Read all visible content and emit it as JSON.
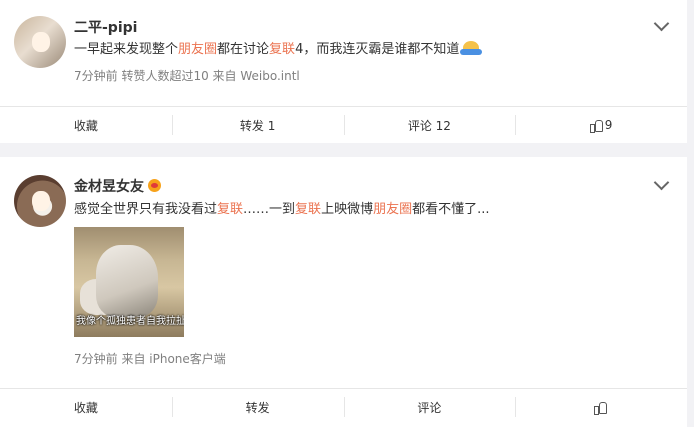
{
  "posts": [
    {
      "username": "二平-pipi",
      "text_parts": [
        "一早起来发现整个",
        "朋友圈",
        "都在讨论",
        "复联",
        "4，而我连灭霸是谁都不知道"
      ],
      "meta": "7分钟前 转赞人数超过10 来自 Weibo.intl",
      "actions": {
        "favorite": "收藏",
        "repost": "转发 1",
        "comment": "评论 12",
        "like": "9"
      }
    },
    {
      "username": "金材昱女友",
      "text_parts": [
        "感觉全世界只有我没看过",
        "复联",
        "……一到",
        "复联",
        "上映微博",
        "朋友圈",
        "都看不懂了..."
      ],
      "image_caption": "我像个孤独患者自我拉扯",
      "meta": "7分钟前 来自 iPhone客户端",
      "actions": {
        "favorite": "收藏",
        "repost": "转发",
        "comment": "评论",
        "like": ""
      }
    }
  ],
  "colors": {
    "highlight": "#eb7350",
    "meta": "#808080",
    "background": "#f2f2f5"
  },
  "icons": [
    "chevron-down-icon",
    "thumbs-up-icon",
    "verified-badge-icon",
    "emoji-icon"
  ]
}
